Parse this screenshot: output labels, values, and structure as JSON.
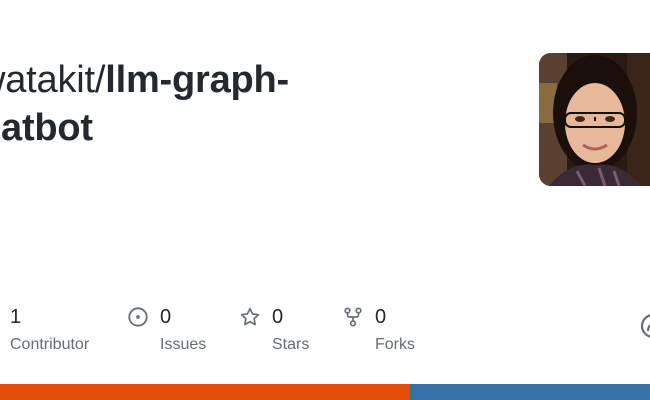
{
  "repo": {
    "owner_prefix": "watakit/",
    "name_line1": "llm-graph-",
    "name_line2": "hatbot"
  },
  "stats": {
    "contributors": {
      "value": "1",
      "label": "Contributor"
    },
    "issues": {
      "value": "0",
      "label": "Issues",
      "icon": "issue-opened-icon"
    },
    "stars": {
      "value": "0",
      "label": "Stars",
      "icon": "star-icon"
    },
    "forks": {
      "value": "0",
      "label": "Forks",
      "icon": "repo-forked-icon"
    }
  },
  "language_bar": [
    {
      "color": "#e34c0b",
      "fraction": 0.63
    },
    {
      "color": "#3572a5",
      "fraction": 0.37
    }
  ],
  "colors": {
    "text": "#24292f",
    "muted": "#656d76",
    "icon": "#656d76"
  }
}
